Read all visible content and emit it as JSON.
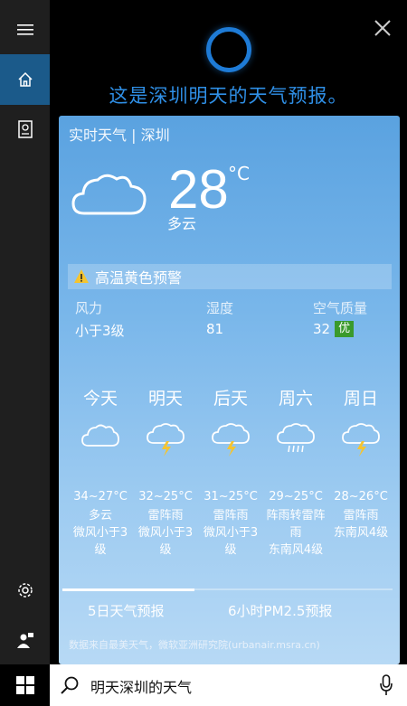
{
  "cortana": {
    "speech": "这是深圳明天的天气预报。"
  },
  "card": {
    "title": "实时天气 | 深圳",
    "temperature": "28",
    "unit": "°C",
    "condition": "多云",
    "alert": "高温黄色预警",
    "stats": [
      {
        "label": "风力",
        "value": "小于3级"
      },
      {
        "label": "湿度",
        "value": "81"
      },
      {
        "label": "空气质量",
        "value": "32",
        "badge": "优"
      }
    ],
    "forecast": [
      {
        "day": "今天",
        "icon": "cloud-icon",
        "range": "34~27°C",
        "cond": "多云",
        "wind_1": "微风小于3",
        "wind_2": "级"
      },
      {
        "day": "明天",
        "icon": "thunderstorm-icon",
        "range": "32~25°C",
        "cond": "雷阵雨",
        "wind_1": "微风小于3",
        "wind_2": "级"
      },
      {
        "day": "后天",
        "icon": "thunderstorm-icon",
        "range": "31~25°C",
        "cond": "雷阵雨",
        "wind_1": "微风小于3",
        "wind_2": "级"
      },
      {
        "day": "周六",
        "icon": "rain-icon",
        "range": "29~25°C",
        "cond": "阵雨转雷阵",
        "wind_1": "雨",
        "wind_2": "东南风4级"
      },
      {
        "day": "周日",
        "icon": "thunderstorm-icon",
        "range": "28~26°C",
        "cond": "雷阵雨",
        "wind_1": "东南风4级",
        "wind_2": ""
      }
    ],
    "tabs": [
      "5日天气预报",
      "6小时PM2.5预报"
    ],
    "source": "数据来自最美天气，微软亚洲研究院(urbanair.msra.cn)"
  },
  "search": {
    "query": "明天深圳的天气"
  },
  "colors": {
    "accent": "#1e7bd6",
    "badge": "#3a9a2c"
  }
}
